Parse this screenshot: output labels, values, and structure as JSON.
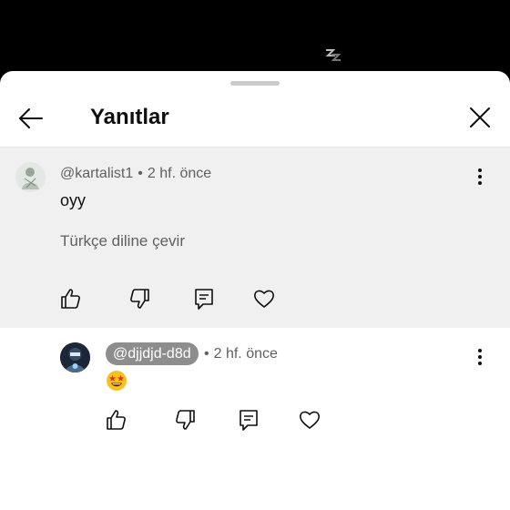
{
  "video": {
    "icon": "loading-glyph"
  },
  "panel": {
    "title": "Yanıtlar",
    "back_icon": "arrow-left-icon",
    "close_icon": "close-icon"
  },
  "comment": {
    "author": "@kartalist1",
    "separator": "•",
    "time": "2 hf. önce",
    "text": "oyy",
    "translate_link": "Türkçe diline çevir",
    "actions": [
      "like-icon",
      "dislike-icon",
      "reply-icon",
      "heart-icon"
    ]
  },
  "reply": {
    "author": "@djjdjd-d8d",
    "separator": "•",
    "time": "2 hf. önce",
    "emoji": "star-struck-emoji",
    "actions": [
      "like-icon",
      "dislike-icon",
      "reply-icon",
      "heart-icon"
    ]
  },
  "colors": {
    "sheet_bg": "#ffffff",
    "highlight_bg": "#f0f0f0",
    "secondary_text": "#606060",
    "chip_bg": "#8d8d8d"
  }
}
